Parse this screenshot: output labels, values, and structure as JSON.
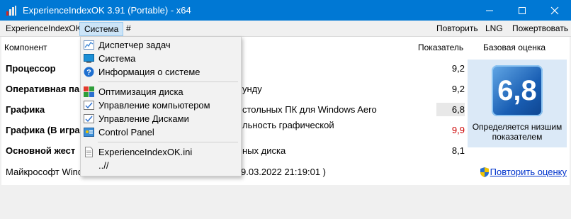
{
  "window": {
    "title": "ExperienceIndexOK 3.91 (Portable) - x64",
    "minimize_icon": "minimize-icon",
    "maximize_icon": "maximize-icon",
    "close_icon": "close-icon"
  },
  "menubar": {
    "app": "ExperienceIndexOK",
    "system": "Система",
    "hash": "#",
    "repeat": "Повторить",
    "lng": "LNG",
    "donate": "Пожертвовать"
  },
  "table": {
    "col_component": "Компонент",
    "col_score": "Показатель",
    "col_base": "Базовая оценка",
    "rows": [
      {
        "label": "Процессор",
        "desc": "",
        "score": "9,2",
        "score_color": "#000000"
      },
      {
        "label": "Оперативная па",
        "desc": "унду",
        "score": "9,2",
        "score_color": "#000000"
      },
      {
        "label": "Графика",
        "desc": "стольных ПК для Windows Aero",
        "score": "6,8",
        "score_color": "#000000"
      },
      {
        "label": "Графика (В игра",
        "desc": "льность графической",
        "score": "9,9",
        "score_color": "#cc0000"
      },
      {
        "label": "Основной жест",
        "desc": "ных диска",
        "score": "8,1",
        "score_color": "#000000"
      }
    ]
  },
  "base_score": {
    "value": "6,8",
    "note_line1": "Определяется низшим",
    "note_line2": "показателем"
  },
  "footer": {
    "text": "Майкрософт Windo",
    "date_text": "9.03.2022 21:19:01 )",
    "repeat_link": "Повторить оценку",
    "shield_icon": "uac-shield-icon"
  },
  "dropdown": {
    "items": [
      {
        "label": "Диспетчер задач",
        "icon": "task-manager-icon"
      },
      {
        "label": "Система",
        "icon": "system-icon"
      },
      {
        "label": "Информация о системе",
        "icon": "info-icon"
      },
      {
        "label": "Оптимизация диска",
        "icon": "defrag-icon"
      },
      {
        "label": "Управление компьютером",
        "icon": "computer-management-icon"
      },
      {
        "label": "Управление Дисками",
        "icon": "disk-management-icon"
      },
      {
        "label": "Control Panel",
        "icon": "control-panel-icon"
      },
      {
        "label": "ExperienceIndexOK.ini",
        "icon": "ini-file-icon"
      },
      {
        "label": "..//",
        "icon": ""
      }
    ]
  }
}
